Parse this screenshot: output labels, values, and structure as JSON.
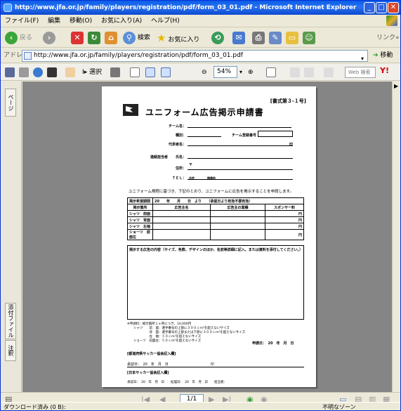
{
  "window": {
    "title": "http://www.jfa.or.jp/family/players/registration/pdf/form_03_01.pdf - Microsoft Internet Explorer",
    "min": "_",
    "max": "□",
    "close": "✕"
  },
  "menu": [
    "ファイル(F)",
    "編集",
    "移動(O)",
    "お気に入り(A)",
    "ヘルプ(H)"
  ],
  "toolbar": {
    "back": "戻る",
    "search": "検索",
    "favorites": "お気に入り",
    "links": "リンク",
    "more": "»"
  },
  "address": {
    "label": "アドレス(D)",
    "url": "http://www.jfa.or.jp/family/players/registration/pdf/form_03_01.pdf",
    "go": "移動"
  },
  "adobe": {
    "select": "選択",
    "zoom": "54%",
    "websearch": "Web 検索",
    "yahoo": "Y!"
  },
  "side_tabs": {
    "pages": "ページ",
    "attachments": "添付ファイル",
    "comments": "注釈"
  },
  "nav": {
    "page": "1/1"
  },
  "status": {
    "left": "ダウンロード済み (0 B):",
    "zone": "不明なゾーン"
  },
  "doc": {
    "form_no": "[書式第３-１号]",
    "title": "ユニフォーム広告掲示申請書",
    "team": "チーム名：",
    "type": "種別：",
    "reg_no": "チーム登録番号",
    "rep": "代表者名：",
    "contact": "連絡担当者",
    "name": "氏名：",
    "address": "住所：",
    "postal": "〒",
    "tel": "ＴＥＬ：",
    "tel_home": "自宅",
    "tel_mobile": "携帯他",
    "seal": "印",
    "intro": "ユニフォーム規程に基づき、下記のとおり、ユニフォームに広告を掲示することを申請します。",
    "period_label": "掲示希望期間",
    "period_value": "20　　年　　月　　日　より　　（承認日より有効不要有効）",
    "col_place": "掲示箇所",
    "col_advertiser": "広告主名",
    "col_item": "広告主の業種",
    "col_sponsor": "スポンサー料",
    "rows": [
      "シャツ　前面",
      "シャツ　背面",
      "シャツ　左袖",
      "ショーツ　前面左"
    ],
    "yen": "円",
    "box_label": "掲示する広告の内容（サイズ、色数、デザインのほか、名前等詳細に記入、または資料を添付してください。）",
    "notes": "※申請料：掲示箇所１ヶ所につき、10,000円\n　　シャツ　　前　面：選手番号の上部に３００ｃｍ²を超えないサイズ\n　　　　　　　背　面：選手番号の上部または下部に３００ｃｍ²を超えないサイズ\n　　　　　　　左　袖：５０ｃｍ²を超えないサイズ\n　　ショーツ　前面左：５０ｃｍ²を超えないサイズ",
    "app_date": "申請日：　20　年　月　日",
    "sec1": "[都道府県サッカー協会記入欄]",
    "sec1_line": "承認日：　20　年　月　日　　　　　　　　　　　　印",
    "sec2": "[日本サッカー協会記入欄]",
    "sec2_line": "承認日：　20　年　月　日　　処理日：　20　年　月　日　　担当者："
  }
}
